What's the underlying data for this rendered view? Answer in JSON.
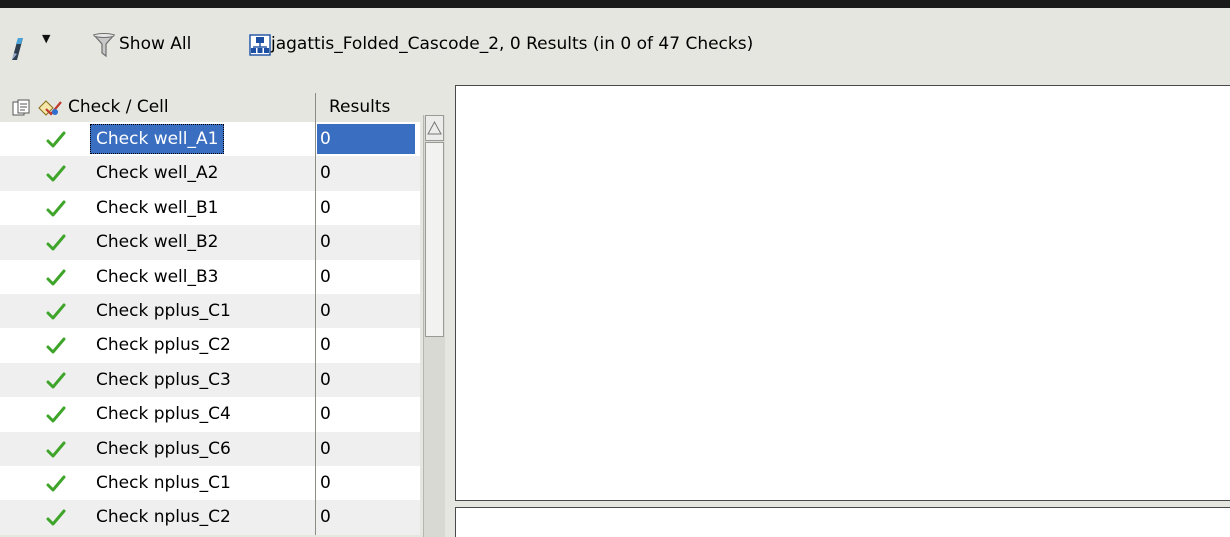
{
  "toolbar": {
    "pen_icon": "pen-icon",
    "dropdown_icon": "dropdown-arrow-icon",
    "filter_icon": "filter-icon",
    "show_all_label": "Show All",
    "hierarchy_icon": "hierarchy-icon",
    "status_text": "jagattis_Folded_Cascode_2, 0 Results (in 0 of 47 Checks)"
  },
  "tree": {
    "header": {
      "column_check_cell": "Check / Cell",
      "column_results": "Results"
    },
    "rows": [
      {
        "name": "Check well_A1",
        "results": "0",
        "status": "passed",
        "selected": true
      },
      {
        "name": "Check well_A2",
        "results": "0",
        "status": "passed",
        "selected": false
      },
      {
        "name": "Check well_B1",
        "results": "0",
        "status": "passed",
        "selected": false
      },
      {
        "name": "Check well_B2",
        "results": "0",
        "status": "passed",
        "selected": false
      },
      {
        "name": "Check well_B3",
        "results": "0",
        "status": "passed",
        "selected": false
      },
      {
        "name": "Check pplus_C1",
        "results": "0",
        "status": "passed",
        "selected": false
      },
      {
        "name": "Check pplus_C2",
        "results": "0",
        "status": "passed",
        "selected": false
      },
      {
        "name": "Check pplus_C3",
        "results": "0",
        "status": "passed",
        "selected": false
      },
      {
        "name": "Check pplus_C4",
        "results": "0",
        "status": "passed",
        "selected": false
      },
      {
        "name": "Check pplus_C6",
        "results": "0",
        "status": "passed",
        "selected": false
      },
      {
        "name": "Check nplus_C1",
        "results": "0",
        "status": "passed",
        "selected": false
      },
      {
        "name": "Check nplus_C2",
        "results": "0",
        "status": "passed",
        "selected": false
      }
    ]
  },
  "colors": {
    "selection": "#3a6ec0",
    "check_green": "#3ea52a",
    "panel_bg": "#e6e6e1"
  }
}
